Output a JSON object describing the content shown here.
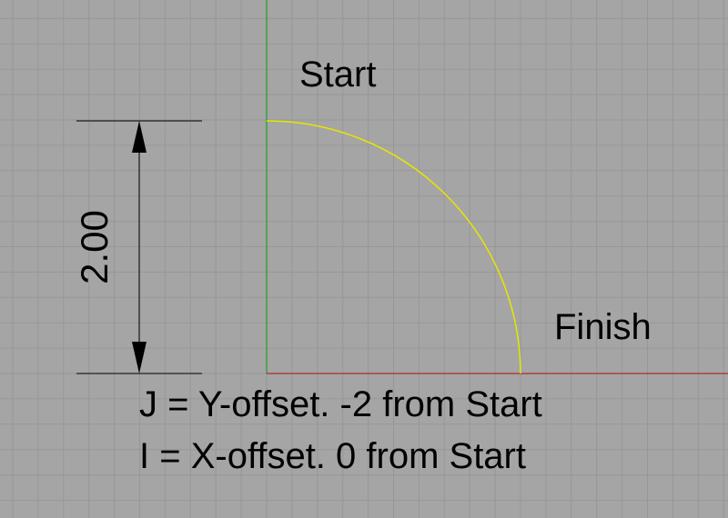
{
  "diagram": {
    "start_label": "Start",
    "finish_label": "Finish",
    "dimension_value": "2.00",
    "notes": [
      "J = Y-offset.  -2 from Start",
      "I = X-offset.  0 from Start"
    ],
    "colors": {
      "background": "#a5a5a5",
      "grid": "#979797",
      "arc": "#e6e600",
      "y_axis": "#1fa01f",
      "x_axis": "#b02a2a",
      "dimension": "#000000"
    }
  }
}
